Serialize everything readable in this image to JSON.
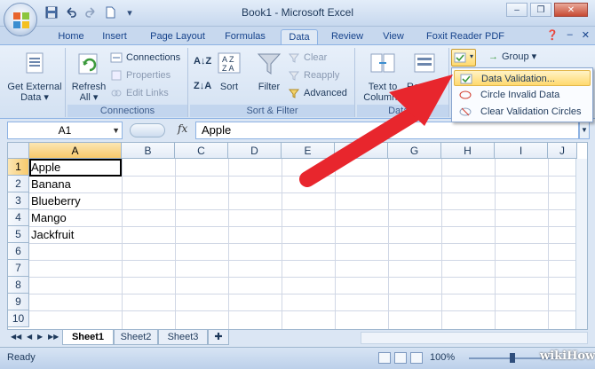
{
  "app": {
    "title": "Book1 - Microsoft Excel"
  },
  "qat": {
    "save_icon": "save-icon",
    "undo_icon": "undo-icon",
    "redo_icon": "redo-icon",
    "new_icon": "new-doc-icon"
  },
  "tabs": [
    {
      "label": "Home"
    },
    {
      "label": "Insert"
    },
    {
      "label": "Page Layout"
    },
    {
      "label": "Formulas"
    },
    {
      "label": "Data"
    },
    {
      "label": "Review"
    },
    {
      "label": "View"
    },
    {
      "label": "Foxit Reader PDF"
    }
  ],
  "ribbon": {
    "get_external_line1": "Get External",
    "get_external_line2": "Data ▾",
    "refresh_line1": "Refresh",
    "refresh_line2": "All ▾",
    "connections": "Connections",
    "properties": "Properties",
    "edit_links": "Edit Links",
    "group_connections": "Connections",
    "sort": "Sort",
    "filter": "Filter",
    "clear": "Clear",
    "reapply": "Reapply",
    "advanced": "Advanced",
    "group_sort_filter": "Sort & Filter",
    "text_to_line1": "Text to",
    "text_to_line2": "Columns",
    "remove_line1": "Remove",
    "remove_line2": "Dup",
    "group_data_tools": "Data T",
    "group_btn": "Group ▾"
  },
  "menu": {
    "items": [
      {
        "label": "Data Validation..."
      },
      {
        "label": "Circle Invalid Data"
      },
      {
        "label": "Clear Validation Circles"
      }
    ]
  },
  "formula_bar": {
    "name_box": "A1",
    "fx": "fx",
    "value": "Apple"
  },
  "sheet": {
    "columns": [
      "A",
      "B",
      "C",
      "D",
      "E",
      "F",
      "G",
      "H",
      "I",
      "J"
    ],
    "rows": [
      "1",
      "2",
      "3",
      "4",
      "5",
      "6",
      "7",
      "8",
      "9",
      "10"
    ],
    "cells": [
      "Apple",
      "Banana",
      "Blueberry",
      "Mango",
      "Jackfruit"
    ]
  },
  "sheet_tabs": [
    "Sheet1",
    "Sheet2",
    "Sheet3"
  ],
  "status": {
    "mode": "Ready",
    "zoom": "100%"
  },
  "watermark": "wikiHow",
  "colors": {
    "arrow": "#e8262d",
    "accent": "#15428b",
    "highlight": "#ffd96e"
  }
}
